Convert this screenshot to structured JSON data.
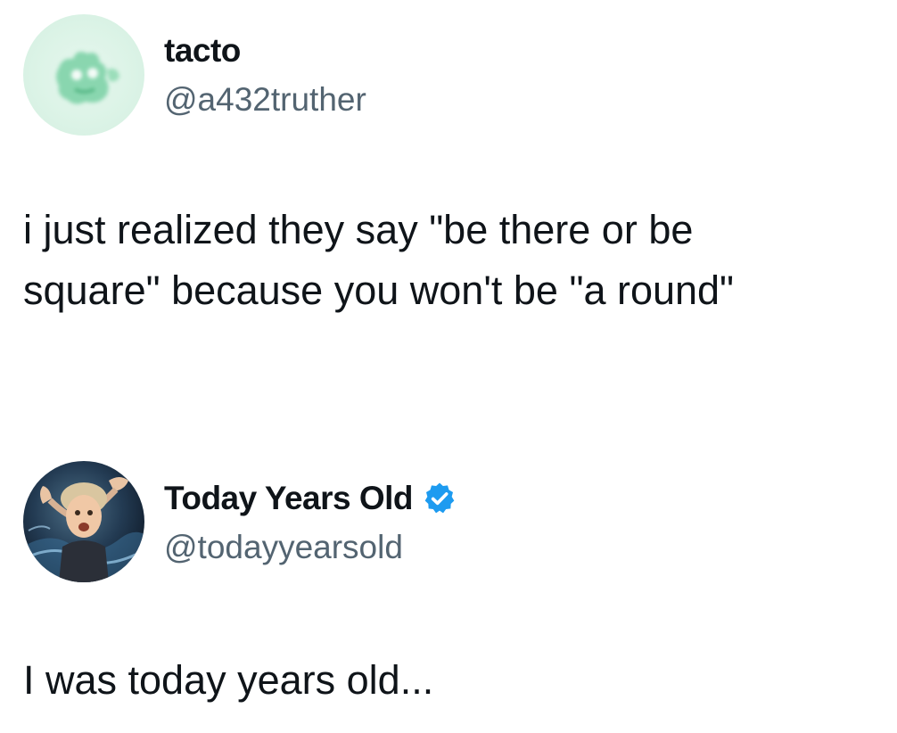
{
  "posts": [
    {
      "display_name": "tacto",
      "handle": "@a432truther",
      "verified": false,
      "avatar_icon": "blurred-green-cartoon-avatar",
      "text": "i just realized they say \"be there or be\nsquare\" because you won't be \"a round\""
    },
    {
      "display_name": "Today Years Old",
      "handle": "@todayyearsold",
      "verified": true,
      "verified_color": "#1d9bf0",
      "avatar_icon": "mind-blown-person-avatar",
      "text": "I was today years old..."
    }
  ]
}
